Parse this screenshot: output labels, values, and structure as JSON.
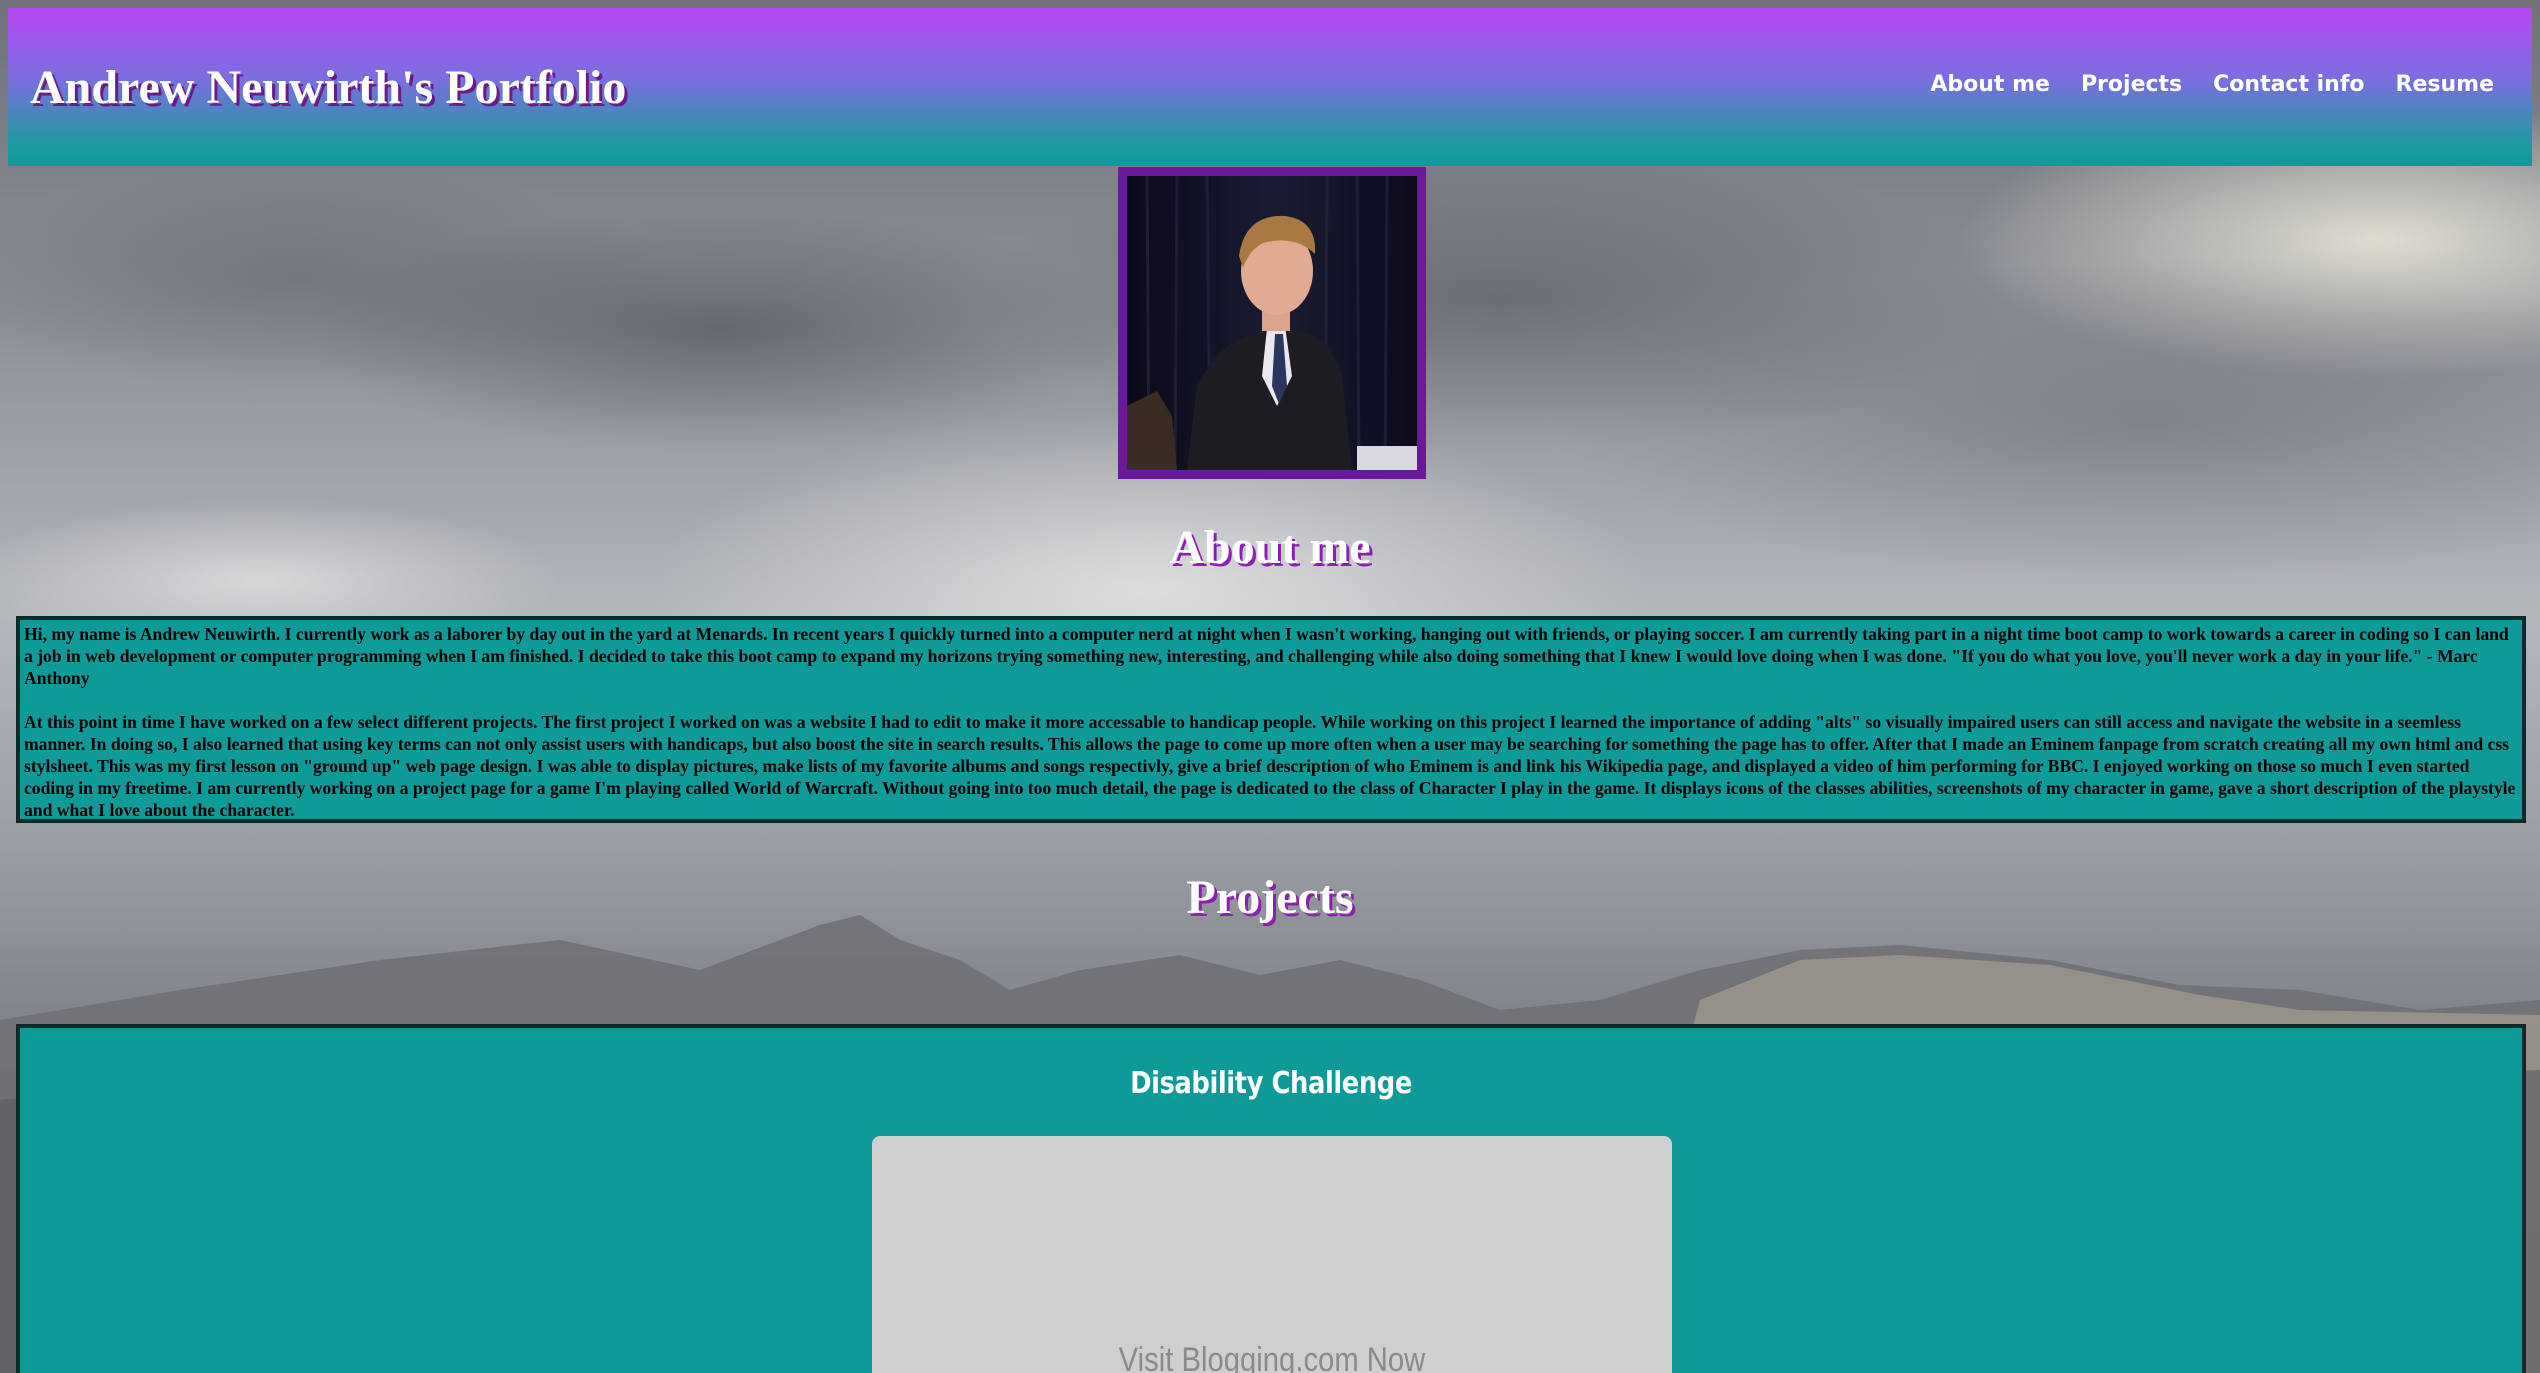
{
  "header": {
    "title": "Andrew Neuwirth's Portfolio",
    "nav": [
      "About me",
      "Projects",
      "Contact info",
      "Resume"
    ]
  },
  "profile": {
    "image_description": "portrait photo"
  },
  "about": {
    "heading": "About me",
    "paragraphs": [
      "Hi, my name is Andrew Neuwirth. I currently work as a laborer by day out in the yard at Menards. In recent years I quickly turned into a computer nerd at night when I wasn't working, hanging out with friends, or playing soccer. I am currently taking part in a night time boot camp to work towards a career in coding so I can land a job in web development or computer programming when I am finished. I decided to take this boot camp to expand my horizons trying something new, interesting, and challenging while also doing something that I knew I would love doing when I was done. \"If you do what you love, you'll never work a day in your life.\" - Marc Anthony",
      "At this point in time I have worked on a few select different projects. The first project I worked on was a website I had to edit to make it more accessable to handicap people. While working on this project I learned the importance of adding \"alts\" so visually impaired users can still access and navigate the website in a seemless manner. In doing so, I also learned that using key terms can not only assist users with handicaps, but also boost the site in search results. This allows the page to come up more often when a user may be searching for something the page has to offer. After that I made an Eminem fanpage from scratch creating all my own html and css stylsheet. This was my first lesson on \"ground up\" web page design. I was able to display pictures, make lists of my favorite albums and songs respectivly, give a brief description of who Eminem is and link his Wikipedia page, and displayed a video of him performing for BBC. I enjoyed working on those so much I even started coding in my freetime. I am currently working on a project page for a game I'm playing called World of Warcraft. Without going into too much detail, the page is dedicated to the class of Character I play in the game. It displays icons of the classes abilities, screenshots of my character in game, gave a short description of the playstyle and what I love about the character."
    ]
  },
  "projects": {
    "heading": "Projects",
    "items": [
      {
        "title": "Disability Challenge",
        "preview_text": "Visit Blogging.com Now"
      }
    ]
  },
  "colors": {
    "header_top": "#b847f5",
    "header_bottom": "#0e9a98",
    "box_background": "#0e9a98",
    "frame": "#6a1a98",
    "heading_shadow": "#8a1fb0"
  }
}
